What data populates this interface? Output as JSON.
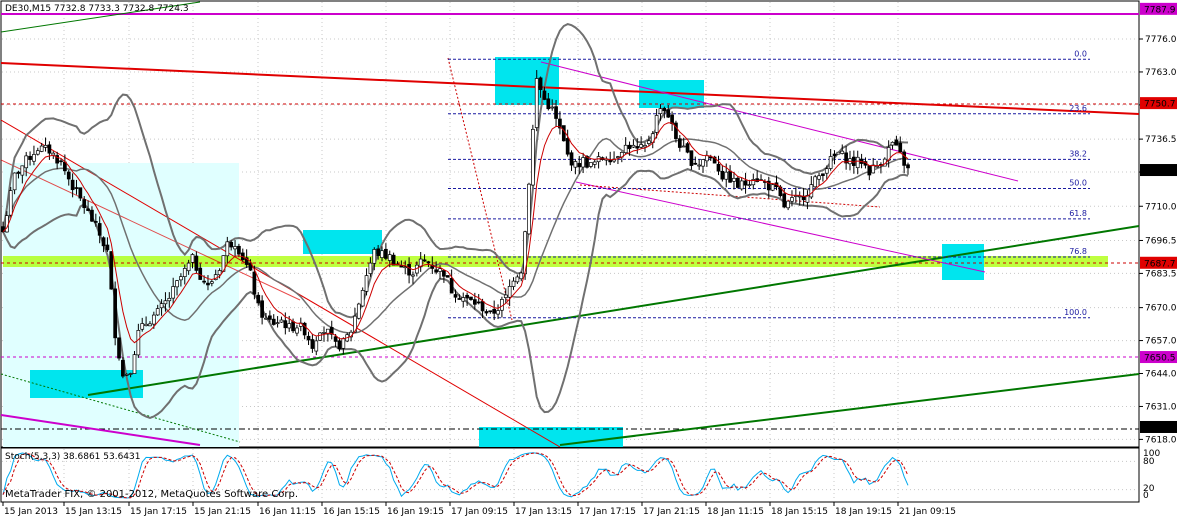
{
  "chart": {
    "header": "DE30,M15  7732.8 7733.3 7732.8 7724.3",
    "watermark": "MetaTrader FIX, © 2001-2012, MetaQuotes Software Corp.",
    "stoch_label": "Stoch(5,3,3) 38.6861 53.6431",
    "stoch_scale": [
      "100",
      "80",
      "20",
      "0"
    ],
    "colors": {
      "bull": "#ffffff",
      "bear": "#000000",
      "band": "#707070",
      "ma": "#cc0000",
      "trend_red": "#e00000",
      "green": "#007700",
      "magenta": "#cc00cc",
      "cyan": "#00e5ee",
      "cyan_light": "#e0ffff",
      "lime": "#aaff00",
      "fib": "#1a1aa0",
      "stoch_main": "#00aaee",
      "stoch_signal": "#cc0000"
    }
  },
  "chart_data": {
    "type": "candlestick",
    "symbol": "DE30",
    "timeframe": "M15",
    "ylim": [
      7615,
      7791
    ],
    "y_ticks": [
      "7776.0",
      "7763.0",
      "7750.0",
      "7736.5",
      "7723.5",
      "7710.0",
      "7696.5",
      "7683.5",
      "7670.0",
      "7657.0",
      "7644.0",
      "7631.0",
      "7618.0"
    ],
    "y_tick_values": [
      7776.0,
      7763.0,
      7750.0,
      7736.5,
      7723.5,
      7710.0,
      7696.5,
      7683.5,
      7670.0,
      7657.0,
      7644.0,
      7631.0,
      7618.0
    ],
    "x_ticks": [
      "15 Jan 2013",
      "15 Jan 13:15",
      "15 Jan 17:15",
      "15 Jan 21:15",
      "16 Jan 11:15",
      "16 Jan 15:15",
      "16 Jan 19:15",
      "17 Jan 09:15",
      "17 Jan 13:15",
      "17 Jan 17:15",
      "17 Jan 21:15",
      "18 Jan 11:15",
      "18 Jan 15:15",
      "18 Jan 19:15",
      "21 Jan 09:15"
    ],
    "price_labels": [
      {
        "text": "7787.9",
        "value": 7787.9,
        "color": "#cc00cc"
      },
      {
        "text": "7750.7",
        "value": 7750.7,
        "color": "#e00000"
      },
      {
        "text": "7724.3",
        "value": 7724.3,
        "color": "#000000"
      },
      {
        "text": "7687.7",
        "value": 7687.7,
        "color": "#e00000"
      },
      {
        "text": "7650.5",
        "value": 7650.5,
        "color": "#cc00cc"
      },
      {
        "text": "7622.9",
        "value": 7622.9,
        "color": "#000000"
      }
    ],
    "fibonacci": [
      {
        "level": "0.0",
        "price": 7768.0
      },
      {
        "level": "23.6",
        "price": 7746.5
      },
      {
        "level": "38.2",
        "price": 7728.5
      },
      {
        "level": "50.0",
        "price": 7717.0
      },
      {
        "level": "61.8",
        "price": 7705.0
      },
      {
        "level": "76.8",
        "price": 7690.0
      },
      {
        "level": "100.0",
        "price": 7666.0
      }
    ],
    "close_path": [
      [
        0,
        7700
      ],
      [
        3,
        7722
      ],
      [
        6,
        7728
      ],
      [
        9,
        7733
      ],
      [
        12,
        7732
      ],
      [
        15,
        7727
      ],
      [
        18,
        7718
      ],
      [
        21,
        7710
      ],
      [
        24,
        7702
      ],
      [
        27,
        7692
      ],
      [
        29,
        7660
      ],
      [
        31,
        7643
      ],
      [
        33,
        7646
      ],
      [
        35,
        7660
      ],
      [
        37,
        7664
      ],
      [
        40,
        7668
      ],
      [
        43,
        7674
      ],
      [
        46,
        7682
      ],
      [
        49,
        7689
      ],
      [
        51,
        7683
      ],
      [
        53,
        7678
      ],
      [
        56,
        7686
      ],
      [
        58,
        7695
      ],
      [
        60,
        7696
      ],
      [
        62,
        7690
      ],
      [
        64,
        7683
      ],
      [
        66,
        7670
      ],
      [
        68,
        7665
      ],
      [
        70,
        7664
      ],
      [
        72,
        7665
      ],
      [
        74,
        7662
      ],
      [
        76,
        7663
      ],
      [
        78,
        7661
      ],
      [
        80,
        7655
      ],
      [
        82,
        7662
      ],
      [
        84,
        7660
      ],
      [
        86,
        7655
      ],
      [
        88,
        7656
      ],
      [
        90,
        7661
      ],
      [
        92,
        7672
      ],
      [
        94,
        7683
      ],
      [
        96,
        7692
      ],
      [
        98,
        7691
      ],
      [
        100,
        7690
      ],
      [
        102,
        7687
      ],
      [
        104,
        7685
      ],
      [
        106,
        7684
      ],
      [
        108,
        7688
      ],
      [
        110,
        7688
      ],
      [
        112,
        7685
      ],
      [
        114,
        7684
      ],
      [
        116,
        7677
      ],
      [
        118,
        7675
      ],
      [
        120,
        7673
      ],
      [
        122,
        7672
      ],
      [
        124,
        7670
      ],
      [
        126,
        7667
      ],
      [
        128,
        7670
      ],
      [
        130,
        7674
      ],
      [
        132,
        7682
      ],
      [
        134,
        7685
      ],
      [
        135,
        7700
      ],
      [
        136,
        7720
      ],
      [
        137,
        7740
      ],
      [
        138,
        7760
      ],
      [
        139,
        7756
      ],
      [
        140,
        7752
      ],
      [
        142,
        7748
      ],
      [
        144,
        7740
      ],
      [
        146,
        7730
      ],
      [
        148,
        7726
      ],
      [
        150,
        7728
      ],
      [
        152,
        7726
      ],
      [
        154,
        7728
      ],
      [
        156,
        7730
      ],
      [
        158,
        7729
      ],
      [
        160,
        7733
      ],
      [
        162,
        7734
      ],
      [
        164,
        7732
      ],
      [
        166,
        7733
      ],
      [
        168,
        7740
      ],
      [
        170,
        7750
      ],
      [
        172,
        7746
      ],
      [
        174,
        7737
      ],
      [
        176,
        7732
      ],
      [
        178,
        7728
      ],
      [
        180,
        7727
      ],
      [
        182,
        7730
      ],
      [
        184,
        7728
      ],
      [
        186,
        7722
      ],
      [
        188,
        7721
      ],
      [
        190,
        7718
      ],
      [
        192,
        7719
      ],
      [
        194,
        7722
      ],
      [
        196,
        7720
      ],
      [
        198,
        7718
      ],
      [
        200,
        7716
      ],
      [
        202,
        7710
      ],
      [
        204,
        7712
      ],
      [
        206,
        7713
      ],
      [
        208,
        7716
      ],
      [
        210,
        7720
      ],
      [
        212,
        7724
      ],
      [
        214,
        7728
      ],
      [
        216,
        7731
      ],
      [
        218,
        7729
      ],
      [
        220,
        7727
      ],
      [
        222,
        7728
      ],
      [
        224,
        7724
      ],
      [
        226,
        7726
      ],
      [
        228,
        7730
      ],
      [
        230,
        7735
      ],
      [
        232,
        7730
      ],
      [
        234,
        7724.3
      ]
    ],
    "title": "",
    "xlabel": "",
    "ylabel": ""
  }
}
